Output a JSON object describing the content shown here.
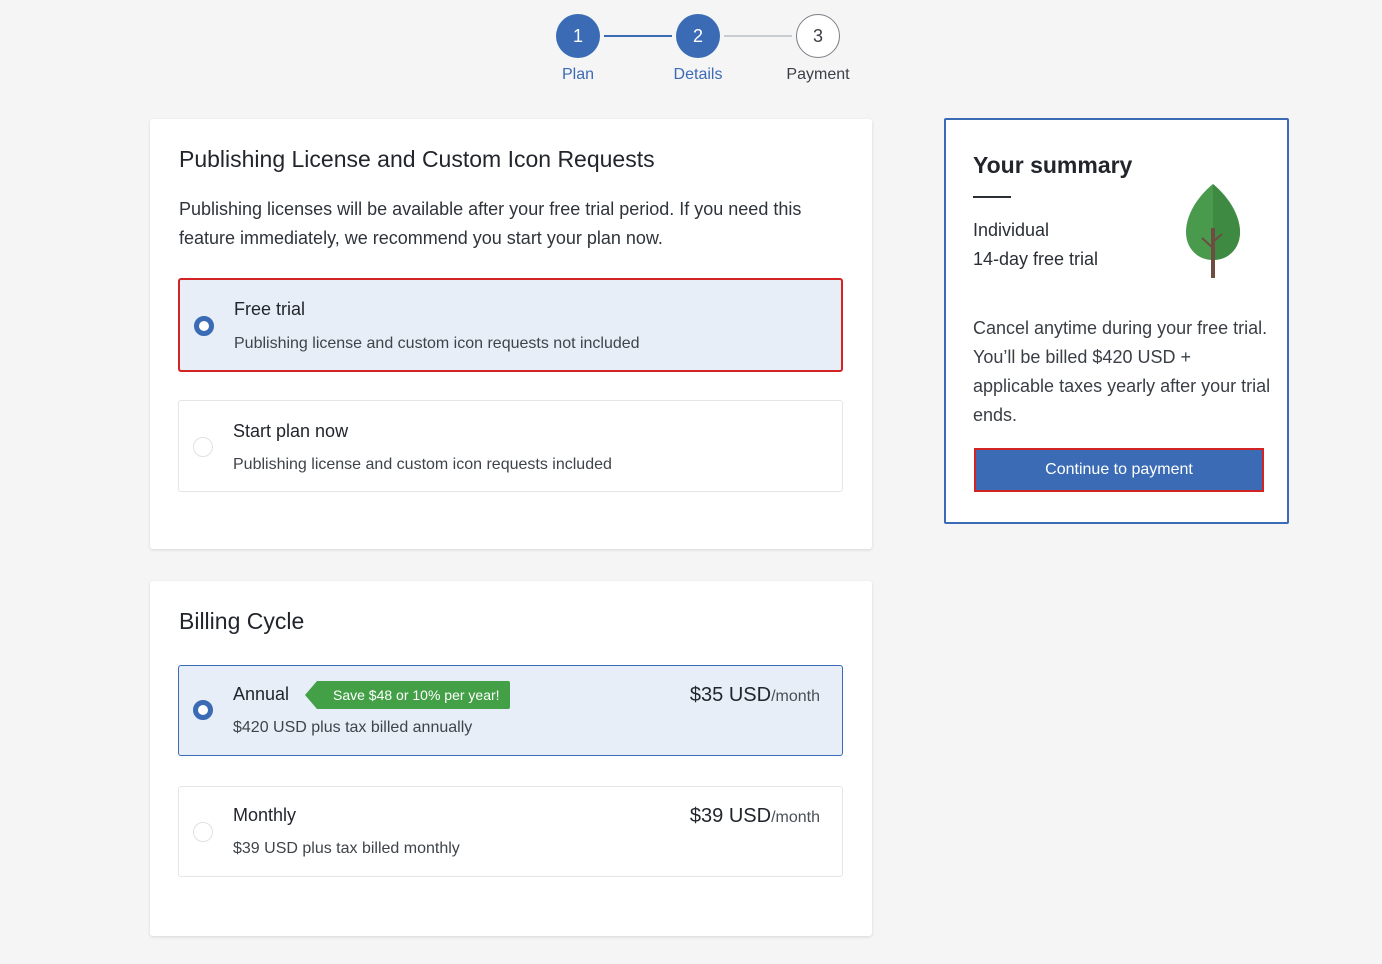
{
  "stepper": {
    "steps": [
      {
        "number": "1",
        "label": "Plan",
        "state": "done"
      },
      {
        "number": "2",
        "label": "Details",
        "state": "done"
      },
      {
        "number": "3",
        "label": "Payment",
        "state": "todo"
      }
    ]
  },
  "license": {
    "title": "Publishing License and Custom Icon Requests",
    "description": "Publishing licenses will be available after your free trial period. If you need this feature immediately, we recommend you start your plan now.",
    "options": [
      {
        "title": "Free trial",
        "subtitle": "Publishing license and custom icon requests not included",
        "selected": true
      },
      {
        "title": "Start plan now",
        "subtitle": "Publishing license and custom icon requests included",
        "selected": false
      }
    ]
  },
  "billing": {
    "title": "Billing Cycle",
    "options": [
      {
        "title": "Annual",
        "badge": "Save $48 or 10% per year!",
        "subtitle": "$420 USD plus tax billed annually",
        "price": "$35 USD",
        "per": "/month",
        "selected": true
      },
      {
        "title": "Monthly",
        "subtitle": "$39 USD plus tax billed monthly",
        "price": "$39 USD",
        "per": "/month",
        "selected": false
      }
    ]
  },
  "summary": {
    "title": "Your summary",
    "plan_line1": "Individual",
    "plan_line2": "14-day free trial",
    "note": "Cancel anytime during your free trial. You’ll be billed $420 USD + applicable taxes yearly after your trial ends.",
    "cta_label": "Continue to payment",
    "icon": "tree-icon"
  },
  "colors": {
    "accent": "#3a6bb4",
    "badge_green": "#43a047",
    "highlight_red": "#d32323",
    "selected_bg": "#e8eef7"
  }
}
